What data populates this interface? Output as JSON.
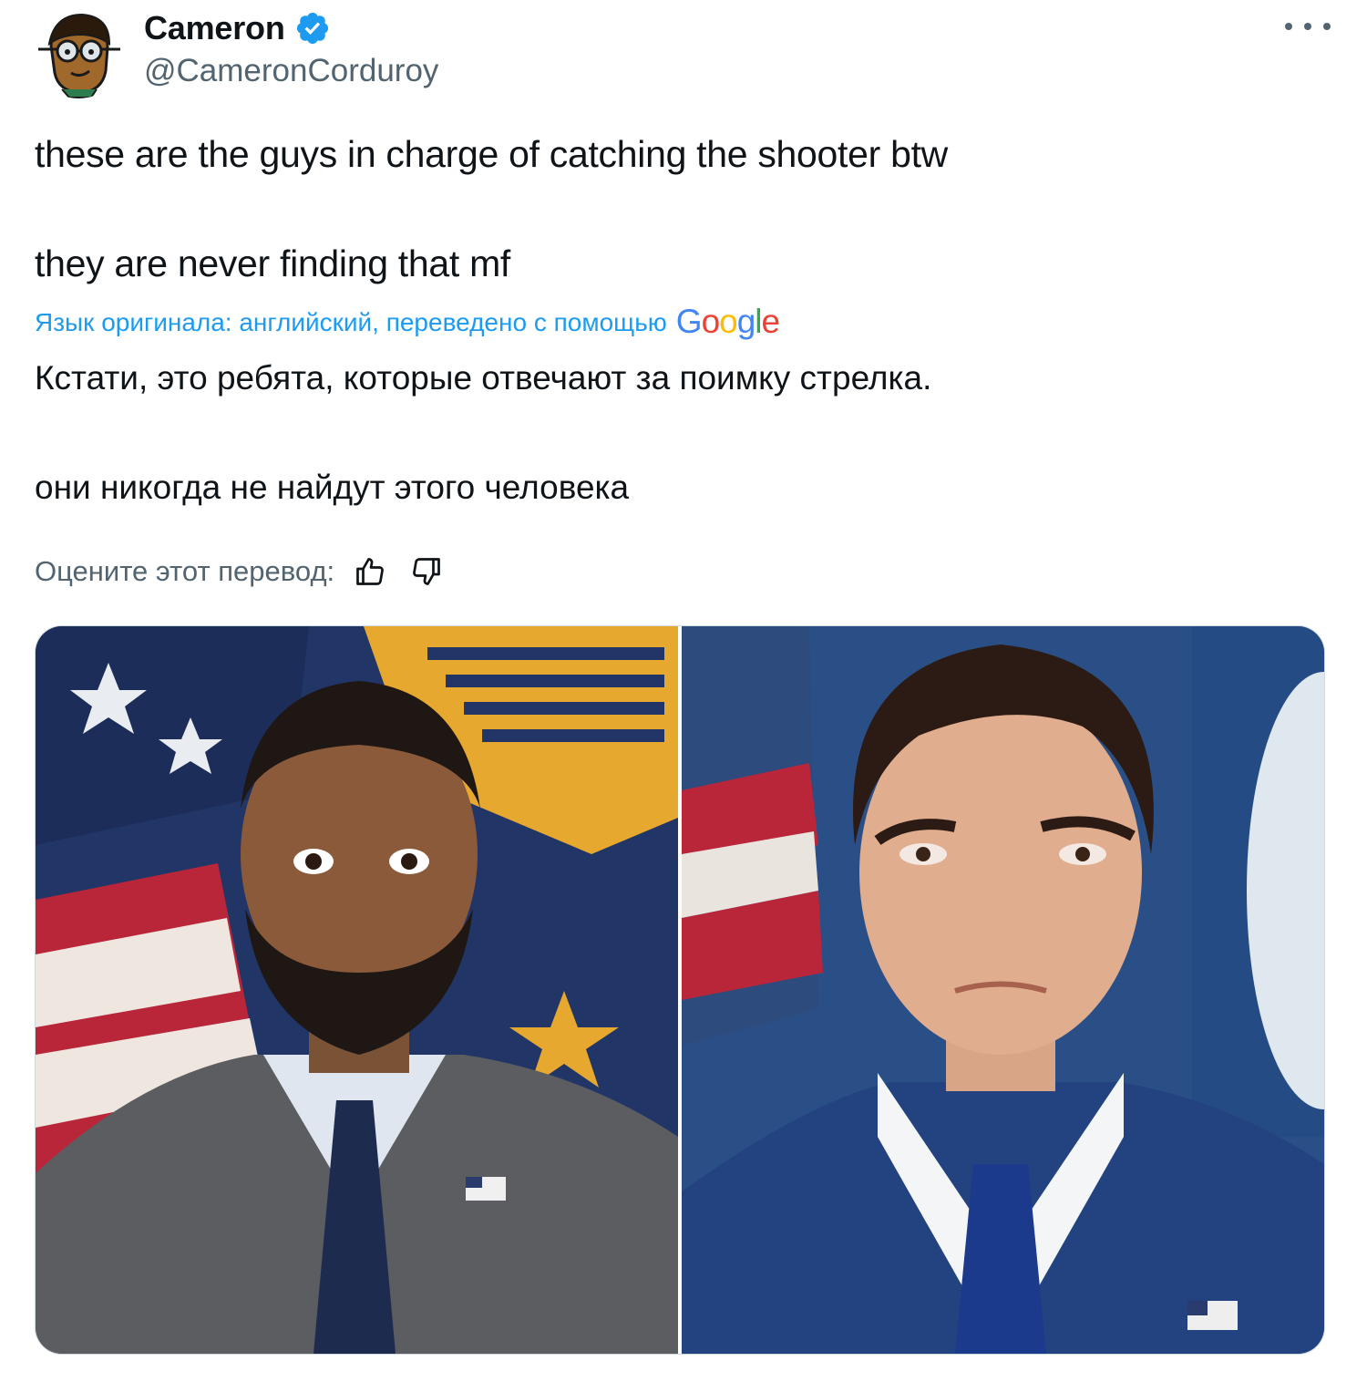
{
  "author": {
    "name": "Cameron",
    "handle": "@CameronCorduroy",
    "avatar_icon": "cartoon-avatar-icon",
    "verified_icon": "verified-badge-icon",
    "verified_color": "#1d9bf0"
  },
  "more_icon": "more-options-icon",
  "tweet": {
    "line1": "these are the guys in charge of catching the shooter btw",
    "line2": "they are never finding that mf"
  },
  "translation": {
    "note": "Язык оригинала: английский, переведено с помощью",
    "provider_letters": [
      "G",
      "o",
      "o",
      "g",
      "l",
      "e"
    ],
    "text_line1": "Кстати, это ребята, которые отвечают за поимку стрелка.",
    "text_line2": "они никогда не найдут этого человека",
    "rate_label": "Оцените этот перевод:",
    "thumbs_up_icon": "thumbs-up-icon",
    "thumbs_down_icon": "thumbs-down-icon"
  },
  "colors": {
    "text": "#0f1419",
    "secondary": "#536471",
    "link": "#1d9bf0",
    "google_blue": "#4285F4",
    "google_red": "#EA4335",
    "google_yellow": "#FBBC05",
    "google_green": "#34A853"
  },
  "media": [
    {
      "icon": "portrait-photo-left"
    },
    {
      "icon": "portrait-photo-right"
    }
  ]
}
